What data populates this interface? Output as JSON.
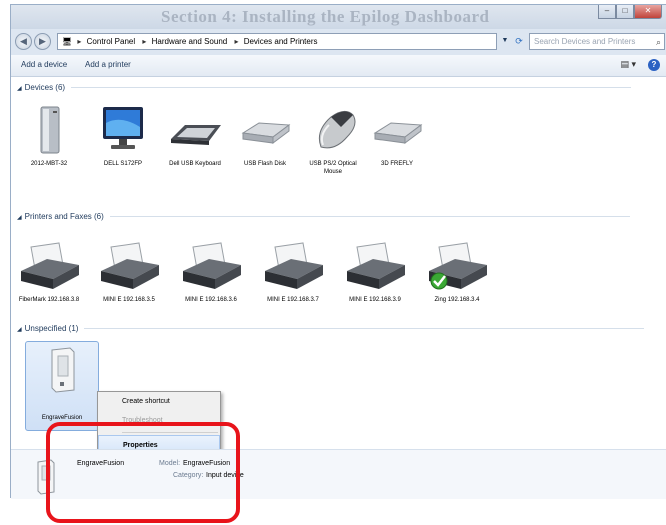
{
  "window": {
    "title": "Section 4: Installing the Epilog Dashboard"
  },
  "caption_buttons": {
    "minimize": "–",
    "maximize": "□",
    "close": "✕"
  },
  "address": {
    "segments": [
      "Control Panel",
      "Hardware and Sound",
      "Devices and Printers"
    ],
    "search_placeholder": "Search Devices and Printers"
  },
  "commandbar": {
    "add_device": "Add a device",
    "add_printer": "Add a printer"
  },
  "groups": {
    "devices": {
      "label": "Devices (6)"
    },
    "printers": {
      "label": "Printers and Faxes (6)"
    },
    "unspecified": {
      "label": "Unspecified (1)"
    }
  },
  "devices": [
    {
      "label": "2012-MBT-32",
      "icon": "computer-tower-icon"
    },
    {
      "label": "DELL S172FP",
      "icon": "monitor-icon"
    },
    {
      "label": "Dell USB Keyboard",
      "icon": "keyboard-icon"
    },
    {
      "label": "USB Flash Disk",
      "icon": "usb-drive-icon"
    },
    {
      "label": "USB PS/2 Optical Mouse",
      "icon": "mouse-icon"
    },
    {
      "label": "3D FREFLY",
      "icon": "usb-drive-icon"
    }
  ],
  "printers": [
    {
      "label": "FiberMark 192.168.3.8",
      "icon": "printer-icon",
      "default": false
    },
    {
      "label": "MINI E 192.168.3.5",
      "icon": "printer-icon",
      "default": false
    },
    {
      "label": "MINI E 192.168.3.6",
      "icon": "printer-icon",
      "default": false
    },
    {
      "label": "MINI E 192.168.3.7",
      "icon": "printer-icon",
      "default": false
    },
    {
      "label": "MINI E 192.168.3.9",
      "icon": "printer-icon",
      "default": false
    },
    {
      "label": "Zing 192.168.3.4",
      "icon": "printer-icon",
      "default": true
    }
  ],
  "unspecified": [
    {
      "label": "EngraveFusion",
      "icon": "engraver-icon"
    }
  ],
  "context_menu": {
    "items": [
      "Create shortcut",
      "Troubleshoot",
      "Properties"
    ],
    "selected": "Properties"
  },
  "details": {
    "name": "EngraveFusion",
    "model_label": "Model:",
    "model_value": "EngraveFusion",
    "category_label": "Category:",
    "category_value": "Input device"
  },
  "colors": {
    "highlight": "#e8141b",
    "accent": "#1e395b"
  }
}
